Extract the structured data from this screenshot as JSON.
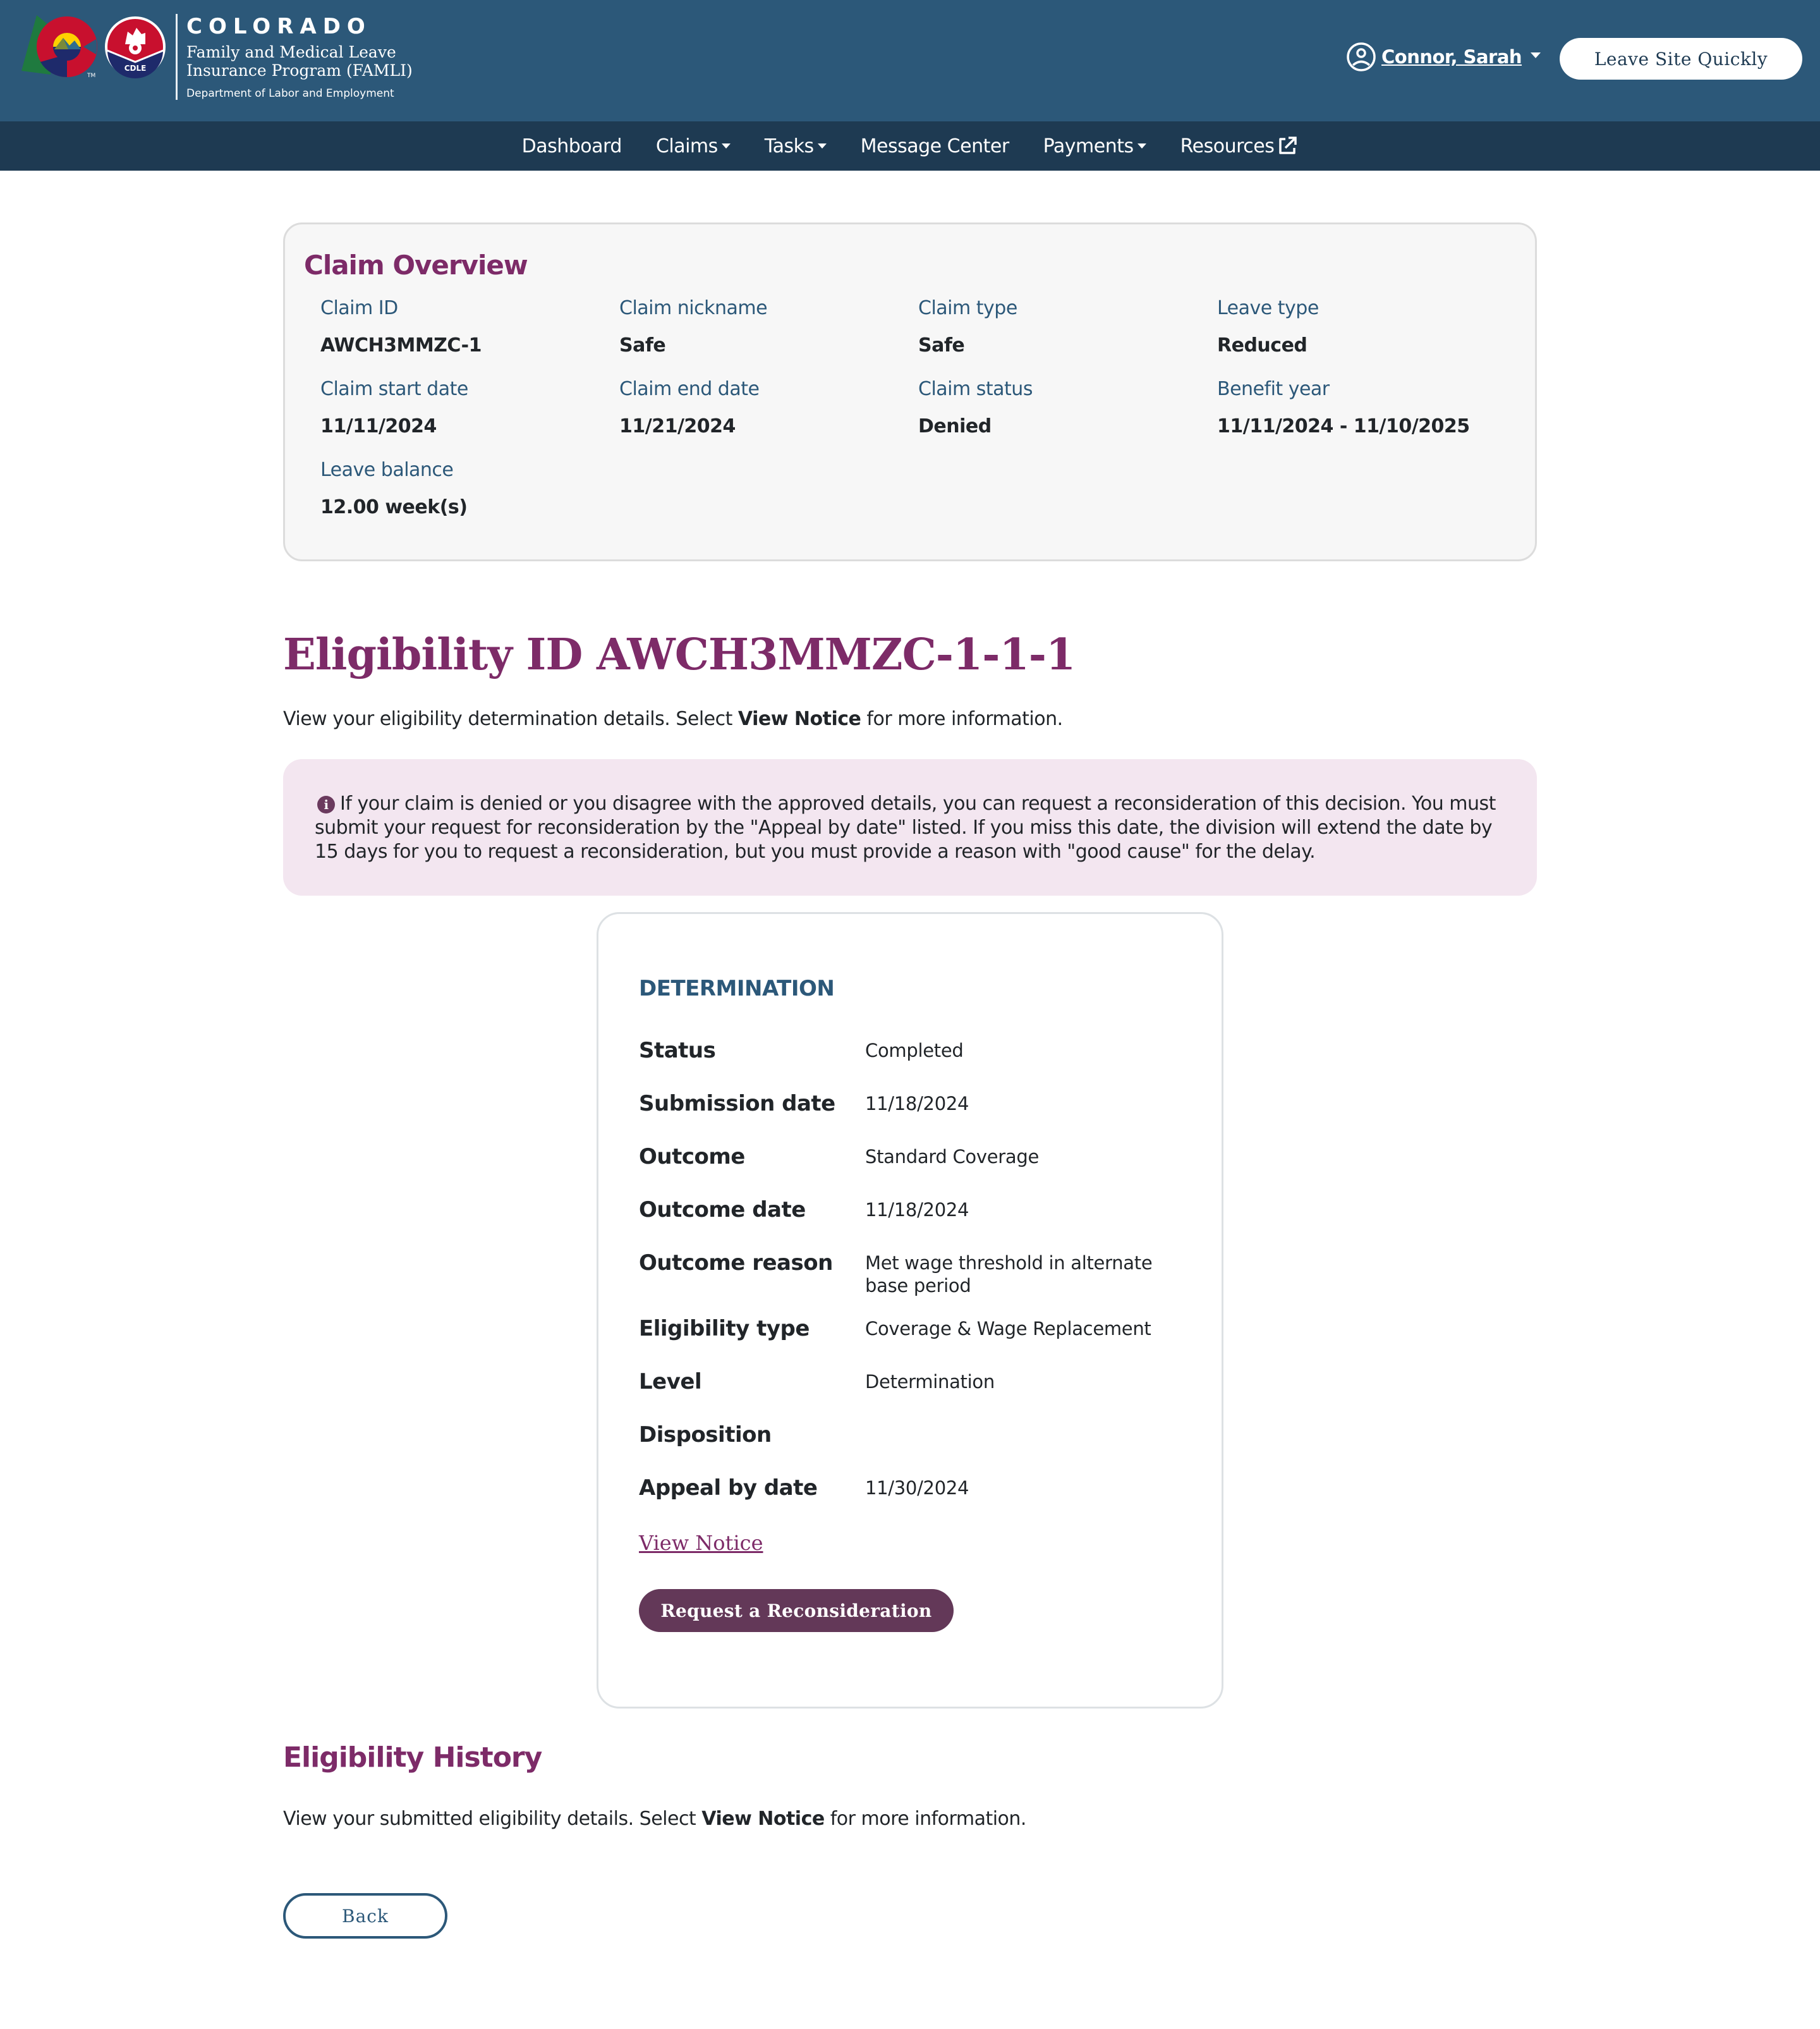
{
  "header": {
    "brand_title": "COLORADO",
    "brand_subtitle_line1": "Family and Medical Leave",
    "brand_subtitle_line2": "Insurance Program (FAMLI)",
    "brand_department": "Department of Labor and Employment",
    "cdle_badge": "CDLE",
    "user_name": "Connor, Sarah",
    "leave_site_label": "Leave Site Quickly",
    "colors": {
      "header_bg": "#2c5879",
      "nav_bg": "#1e3a52"
    }
  },
  "nav": {
    "items": [
      {
        "label": "Dashboard",
        "has_dropdown": false
      },
      {
        "label": "Claims",
        "has_dropdown": true
      },
      {
        "label": "Tasks",
        "has_dropdown": true
      },
      {
        "label": "Message Center",
        "has_dropdown": false
      },
      {
        "label": "Payments",
        "has_dropdown": true
      },
      {
        "label": "Resources",
        "has_dropdown": false,
        "icon": "external-link-icon"
      }
    ]
  },
  "overview": {
    "title": "Claim Overview",
    "fields": [
      {
        "label": "Claim ID",
        "value": "AWCH3MMZC-1"
      },
      {
        "label": "Claim nickname",
        "value": "Safe"
      },
      {
        "label": "Claim type",
        "value": "Safe"
      },
      {
        "label": "Leave type",
        "value": "Reduced"
      },
      {
        "label": "Claim start date",
        "value": "11/11/2024"
      },
      {
        "label": "Claim end date",
        "value": "11/21/2024"
      },
      {
        "label": "Claim status",
        "value": "Denied"
      },
      {
        "label": "Benefit year",
        "value": "11/11/2024 - 11/10/2025"
      },
      {
        "label": "Leave balance",
        "value": "12.00 week(s)"
      }
    ]
  },
  "eligibility": {
    "title": "Eligibility ID AWCH3MMZC-1-1-1",
    "desc_prefix": "View your eligibility determination details. Select ",
    "desc_bold": "View Notice",
    "desc_suffix": " for more information.",
    "alert_icon": "info-icon",
    "alert_text": "If your claim is denied or you disagree with the approved details, you can request a reconsideration of this decision. You must submit your request for reconsideration by the \"Appeal by date\" listed. If you miss this date, the division will extend the date by 15 days for you to request a reconsideration, but you must provide a reason with \"good cause\" for the delay."
  },
  "determination": {
    "title": "DETERMINATION",
    "rows": [
      {
        "label": "Status",
        "value": "Completed"
      },
      {
        "label": "Submission date",
        "value": "11/18/2024"
      },
      {
        "label": "Outcome",
        "value": "Standard Coverage"
      },
      {
        "label": "Outcome date",
        "value": "11/18/2024"
      },
      {
        "label": "Outcome reason",
        "value": "Met wage threshold in alternate base period"
      },
      {
        "label": "Eligibility type",
        "value": "Coverage & Wage Replacement"
      },
      {
        "label": "Level",
        "value": "Determination"
      },
      {
        "label": "Disposition",
        "value": ""
      },
      {
        "label": "Appeal by date",
        "value": "11/30/2024"
      }
    ],
    "view_notice_label": "View Notice",
    "reconsideration_label": "Request a Reconsideration"
  },
  "history": {
    "title": "Eligibility History",
    "desc_prefix": "View your submitted eligibility details. Select ",
    "desc_bold": "View Notice",
    "desc_suffix": " for more information."
  },
  "footer": {
    "back_label": "Back"
  }
}
